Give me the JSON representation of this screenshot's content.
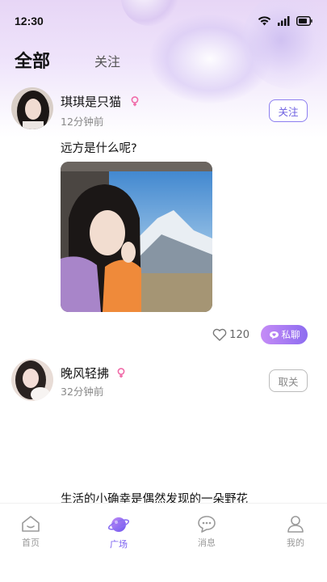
{
  "status_bar": {
    "time": "12:30",
    "icons": [
      "wifi-icon",
      "signal-icon",
      "battery-icon"
    ]
  },
  "tabs": {
    "all": "全部",
    "follow": "关注"
  },
  "posts": [
    {
      "username": "琪琪是只猫",
      "gender": "female",
      "time_ago": "12分钟前",
      "follow_label": "关注",
      "text": "远方是什么呢?",
      "likes": "120",
      "chat_label": "私聊"
    },
    {
      "username": "晚风轻拂",
      "gender": "female",
      "time_ago": "32分钟前",
      "follow_label": "取关",
      "text": "生活的小确幸是偶然发现的一朵野花"
    }
  ],
  "bottom_nav": [
    {
      "label": "首页",
      "icon": "home-icon"
    },
    {
      "label": "广场",
      "icon": "planet-icon",
      "active": true
    },
    {
      "label": "消息",
      "icon": "message-icon"
    },
    {
      "label": "我的",
      "icon": "profile-icon"
    }
  ],
  "colors": {
    "accent": "#7a5ff0",
    "female": "#f06aa8"
  }
}
